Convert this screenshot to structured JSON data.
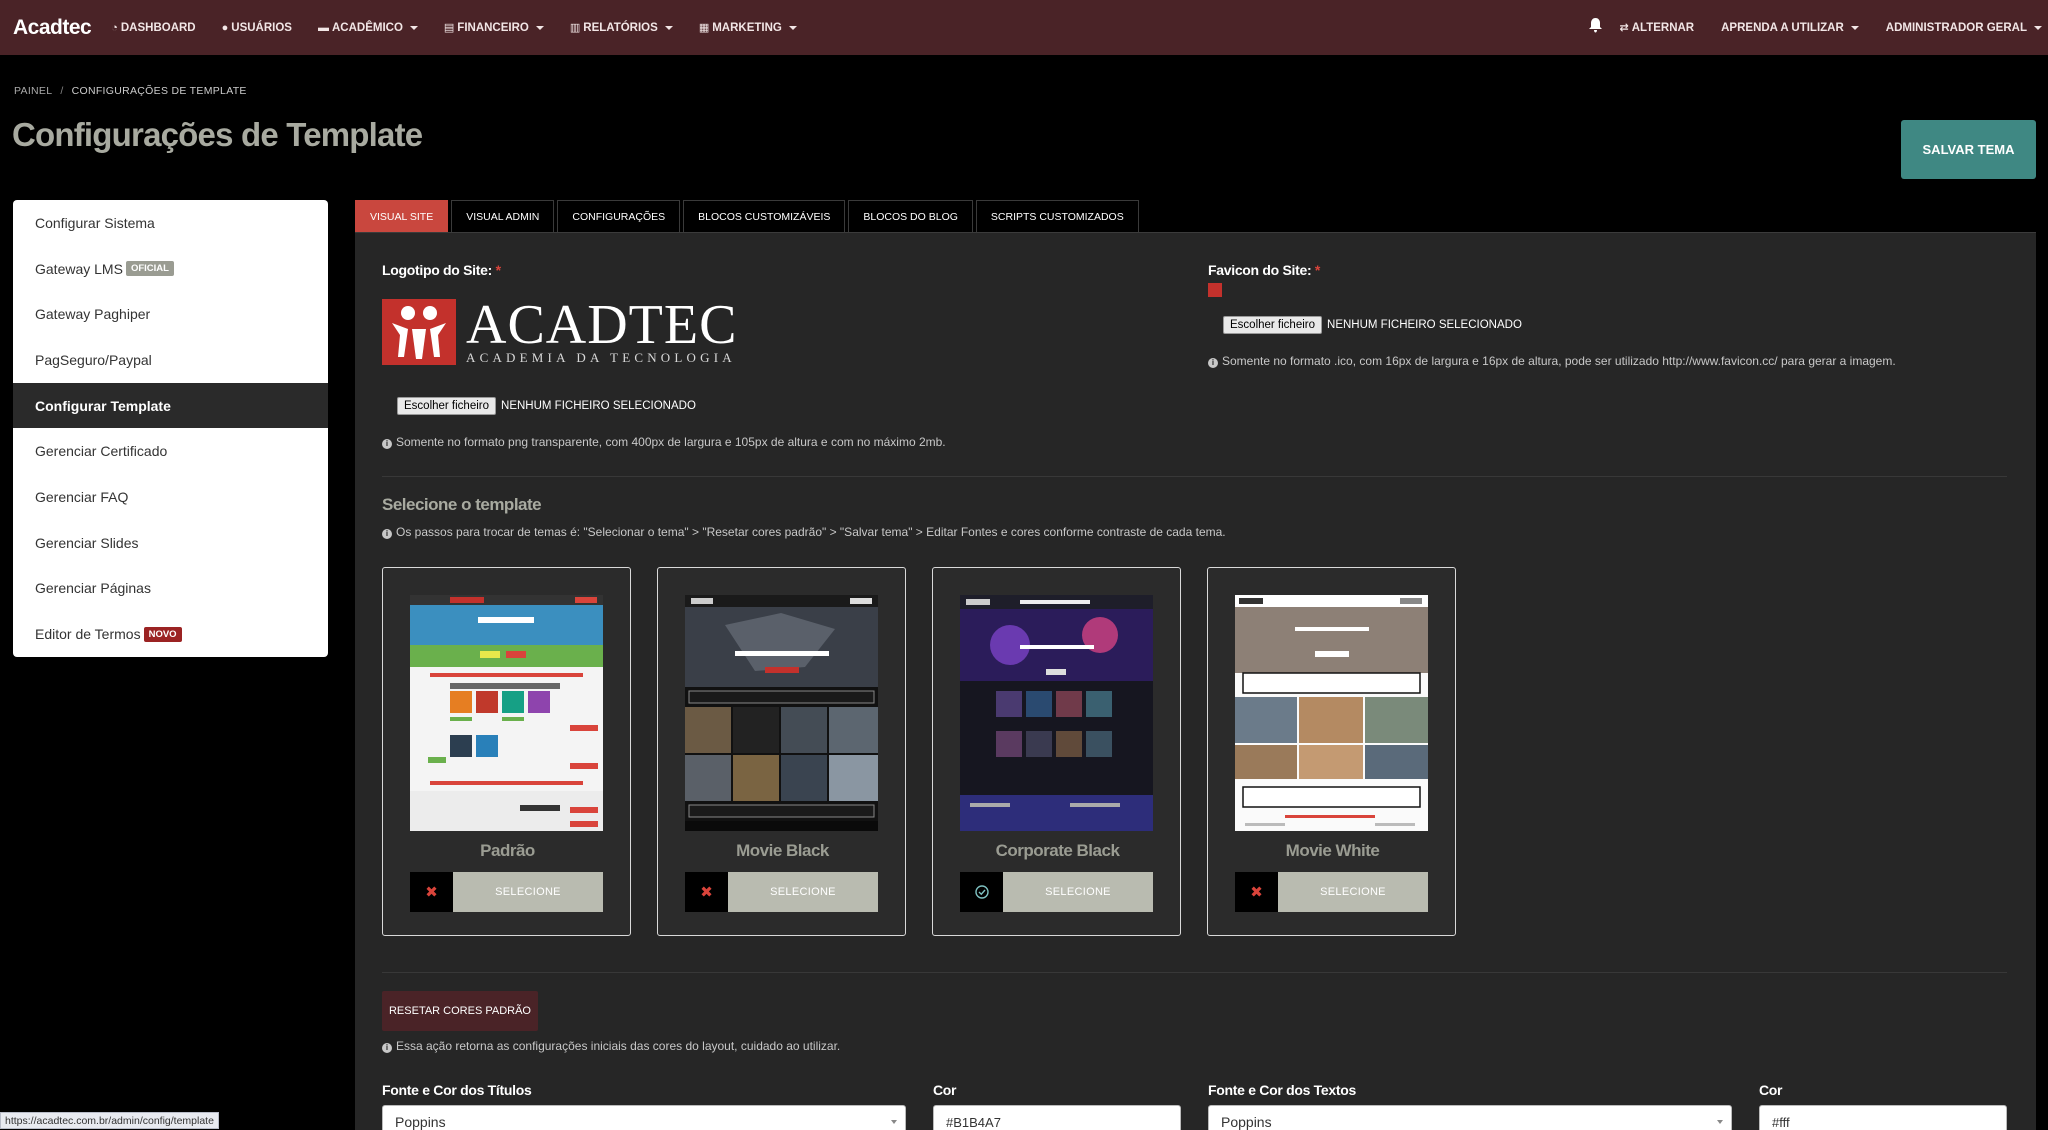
{
  "navbar": {
    "brand": "Acadtec",
    "items": [
      {
        "icon": "dashboard-icon",
        "label": "DASHBOARD"
      },
      {
        "icon": "user-icon",
        "label": "USUÁRIOS"
      },
      {
        "icon": "laptop-icon",
        "label": "ACADÊMICO"
      },
      {
        "icon": "finance-icon",
        "label": "FINANCEIRO"
      },
      {
        "icon": "chart-icon",
        "label": "RELATÓRIOS"
      },
      {
        "icon": "marketing-icon",
        "label": "MARKETING"
      }
    ],
    "right": {
      "switch_label": "ALTERNAR",
      "learn_label": "APRENDA A UTILIZAR",
      "admin_label": "ADMINISTRADOR GERAL"
    }
  },
  "breadcrumb": {
    "root": "PAINEL",
    "current": "CONFIGURAÇÕES DE TEMPLATE"
  },
  "page_title": "Configurações de Template",
  "save_button": "SALVAR TEMA",
  "sidebar": {
    "items": [
      {
        "label": "Configurar Sistema"
      },
      {
        "label": "Gateway LMS",
        "badge": "OFICIAL"
      },
      {
        "label": "Gateway Paghiper"
      },
      {
        "label": "PagSeguro/Paypal"
      },
      {
        "label": "Configurar Template"
      },
      {
        "label": "Gerenciar Certificado"
      },
      {
        "label": "Gerenciar FAQ"
      },
      {
        "label": "Gerenciar Slides"
      },
      {
        "label": "Gerenciar Páginas"
      },
      {
        "label": "Editor de Termos",
        "badge": "NOVO"
      }
    ]
  },
  "tabs": [
    "VISUAL SITE",
    "VISUAL ADMIN",
    "CONFIGURAÇÕES",
    "BLOCOS CUSTOMIZÁVEIS",
    "BLOCOS DO BLOG",
    "SCRIPTS CUSTOMIZADOS"
  ],
  "logo_section": {
    "label": "Logotipo do Site:",
    "required": "*",
    "logo_big": "ACADTEC",
    "logo_small": "ACADEMIA DA TECNOLOGIA",
    "file_button": "Escolher ficheiro",
    "file_status": "NENHUM FICHEIRO SELECIONADO",
    "help": "Somente no formato png transparente, com 400px de largura e 105px de altura e com no máximo 2mb."
  },
  "favicon_section": {
    "label": "Favicon do Site:",
    "required": "*",
    "file_button": "Escolher ficheiro",
    "file_status": "NENHUM FICHEIRO SELECIONADO",
    "help": "Somente no formato .ico, com 16px de largura e 16px de altura, pode ser utilizado http://www.favicon.cc/ para gerar a imagem."
  },
  "template_section": {
    "title": "Selecione o template",
    "help": "Os passos para trocar de temas é: \"Selecionar o tema\" > \"Resetar cores padrão\" > \"Salvar tema\" > Editar Fontes e cores conforme contraste de cada tema.",
    "cards": [
      {
        "name": "Padrão",
        "selected": false,
        "button": "SELECIONE"
      },
      {
        "name": "Movie Black",
        "selected": false,
        "button": "SELECIONE"
      },
      {
        "name": "Corporate Black",
        "selected": true,
        "button": "SELECIONE"
      },
      {
        "name": "Movie White",
        "selected": false,
        "button": "SELECIONE"
      }
    ],
    "movie_black_thumb": {
      "block_top": "BLOCO TOP",
      "block_bottom": "BLOCO BOTTOM",
      "hero": "APRENDA A CRIAR CONTEÚDOS"
    },
    "movie_white_thumb": {
      "block_top": "BLOCO TOPO",
      "block_bottom": "BLOCO INFERIOR"
    }
  },
  "reset_section": {
    "button": "RESETAR CORES PADRÃO",
    "help": "Essa ação retorna as configurações iniciais das cores do layout, cuidado ao utilizar."
  },
  "fonts": {
    "titles_label": "Fonte e Cor dos Títulos",
    "titles_font": "Poppins",
    "titles_color_label": "Cor",
    "titles_color": "#B1B4A7",
    "texts_label": "Fonte e Cor dos Textos",
    "texts_font": "Poppins",
    "texts_color_label": "Cor",
    "texts_color": "#fff"
  },
  "status_url": "https://acadtec.com.br/admin/config/template",
  "colors": {
    "navbar": "#4a2327",
    "accent_red": "#c9473e",
    "save_teal": "#3f8883",
    "select_gray": "#b9bbb0"
  }
}
